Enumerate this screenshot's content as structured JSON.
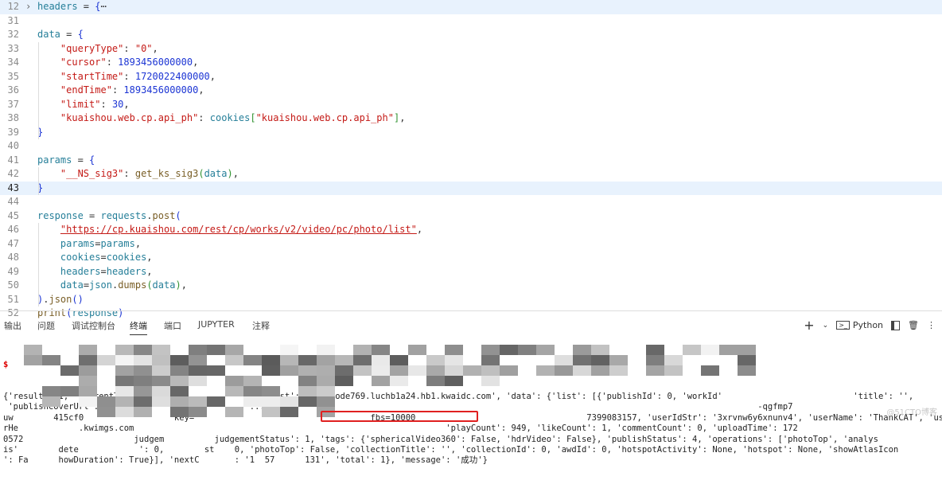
{
  "editor": {
    "lines": [
      {
        "n": "12",
        "folded": true,
        "html": "<span class='k'>headers</span><span class='p'> = </span><span class='b'>{</span><span class='p'>⋯</span>"
      },
      {
        "n": "31",
        "html": ""
      },
      {
        "n": "32",
        "html": "<span class='k'>data</span><span class='p'> = </span><span class='b'>{</span>"
      },
      {
        "n": "33",
        "html": "    <span class='s'>\"queryType\"</span><span class='p'>: </span><span class='s'>\"0\"</span><span class='p'>,</span>"
      },
      {
        "n": "34",
        "html": "    <span class='s'>\"cursor\"</span><span class='p'>: </span><span class='n'>1893456000000</span><span class='p'>,</span>"
      },
      {
        "n": "35",
        "html": "    <span class='s'>\"startTime\"</span><span class='p'>: </span><span class='n'>1720022400000</span><span class='p'>,</span>"
      },
      {
        "n": "36",
        "html": "    <span class='s'>\"endTime\"</span><span class='p'>: </span><span class='n'>1893456000000</span><span class='p'>,</span>"
      },
      {
        "n": "37",
        "html": "    <span class='s'>\"limit\"</span><span class='p'>: </span><span class='n'>30</span><span class='p'>,</span>"
      },
      {
        "n": "38",
        "html": "    <span class='s'>\"kuaishou.web.cp.api_ph\"</span><span class='p'>: </span><span class='k'>cookies</span><span class='g'>[</span><span class='s'>\"kuaishou.web.cp.api_ph\"</span><span class='g'>]</span><span class='p'>,</span>"
      },
      {
        "n": "39",
        "html": "<span class='b'>}</span>"
      },
      {
        "n": "40",
        "html": ""
      },
      {
        "n": "41",
        "html": "<span class='k'>params</span><span class='p'> = </span><span class='b'>{</span>"
      },
      {
        "n": "42",
        "html": "    <span class='s'>\"__NS_sig3\"</span><span class='p'>: </span><span class='f'>get_ks_sig3</span><span class='g'>(</span><span class='k'>data</span><span class='g'>)</span><span class='p'>,</span>"
      },
      {
        "n": "43",
        "current": true,
        "html": "<span class='b'>}</span>"
      },
      {
        "n": "44",
        "html": ""
      },
      {
        "n": "45",
        "html": "<span class='k'>response</span><span class='p'> = </span><span class='k'>requests</span><span class='p'>.</span><span class='f'>post</span><span class='b'>(</span>"
      },
      {
        "n": "46",
        "html": "    <span class='s u'>\"https://cp.kuaishou.com/rest/cp/works/v2/video/pc/photo/list\"</span><span class='p'>,</span>"
      },
      {
        "n": "47",
        "html": "    <span class='k'>params</span><span class='p'>=</span><span class='k'>params</span><span class='p'>,</span>"
      },
      {
        "n": "48",
        "html": "    <span class='k'>cookies</span><span class='p'>=</span><span class='k'>cookies</span><span class='p'>,</span>"
      },
      {
        "n": "49",
        "html": "    <span class='k'>headers</span><span class='p'>=</span><span class='k'>headers</span><span class='p'>,</span>"
      },
      {
        "n": "50",
        "html": "    <span class='k'>data</span><span class='p'>=</span><span class='k'>json</span><span class='p'>.</span><span class='f'>dumps</span><span class='g'>(</span><span class='k'>data</span><span class='g'>)</span><span class='p'>,</span>"
      },
      {
        "n": "51",
        "html": "<span class='b'>)</span><span class='p'>.</span><span class='f'>json</span><span class='b'>()</span>"
      },
      {
        "n": "52",
        "html": "<span class='f'>print</span><span class='b'>(</span><span class='k'>response</span><span class='b'>)</span>"
      }
    ]
  },
  "panel": {
    "tabs": [
      "输出",
      "问题",
      "调试控制台",
      "终端",
      "端口",
      "JUPYTER",
      "注释"
    ],
    "active_tab": "终端",
    "shell": "Python",
    "icons": [
      "plus-icon",
      "chevron-down-icon",
      "terminal-icon",
      "split-icon",
      "trash-icon",
      "more-icon"
    ]
  },
  "terminal": {
    "prompt": "$",
    "lines": [
      "{'result': 1, 'currentTime': 17206...             ...host': 'cke-node769.luchb1a24.hb1.kwaidc.com', 'data': {'list': [{'publishId': 0, 'workId'                          'title': '',",
      " 'publishCoverUrl': 'https://                    ...10/                                                                                               -qgfmp7",
      "uw        415cf0                  key=                                   fbs=10000                                  7399083157, 'userIdStr': '3xrvnw6y6xnunv4', 'userName': 'ThankCAT', 'use",
      "rHe            .kwimgs.com                                                              'playCount': 949, 'likeCount': 1, 'commentCount': 0, 'uploadTime': 172",
      "0572                      judgem          judgementStatus': 1, 'tags': {'sphericalVideo360': False, 'hdrVideo': False}, 'publishStatus': 4, 'operations': ['photoTop', 'analys",
      "is'        dete            ': 0,        st    0, 'photoTop': False, 'collectionTitle': '', 'collectionId': 0, 'awdId': 0, 'hotspotActivity': None, 'hotspot': None, 'showAtlasIcon",
      "': Fa      howDuration': True}], 'nextC       : '1  57      131', 'total': 1}, 'message': '成功'}"
    ]
  },
  "watermark": "@51CTO博客"
}
